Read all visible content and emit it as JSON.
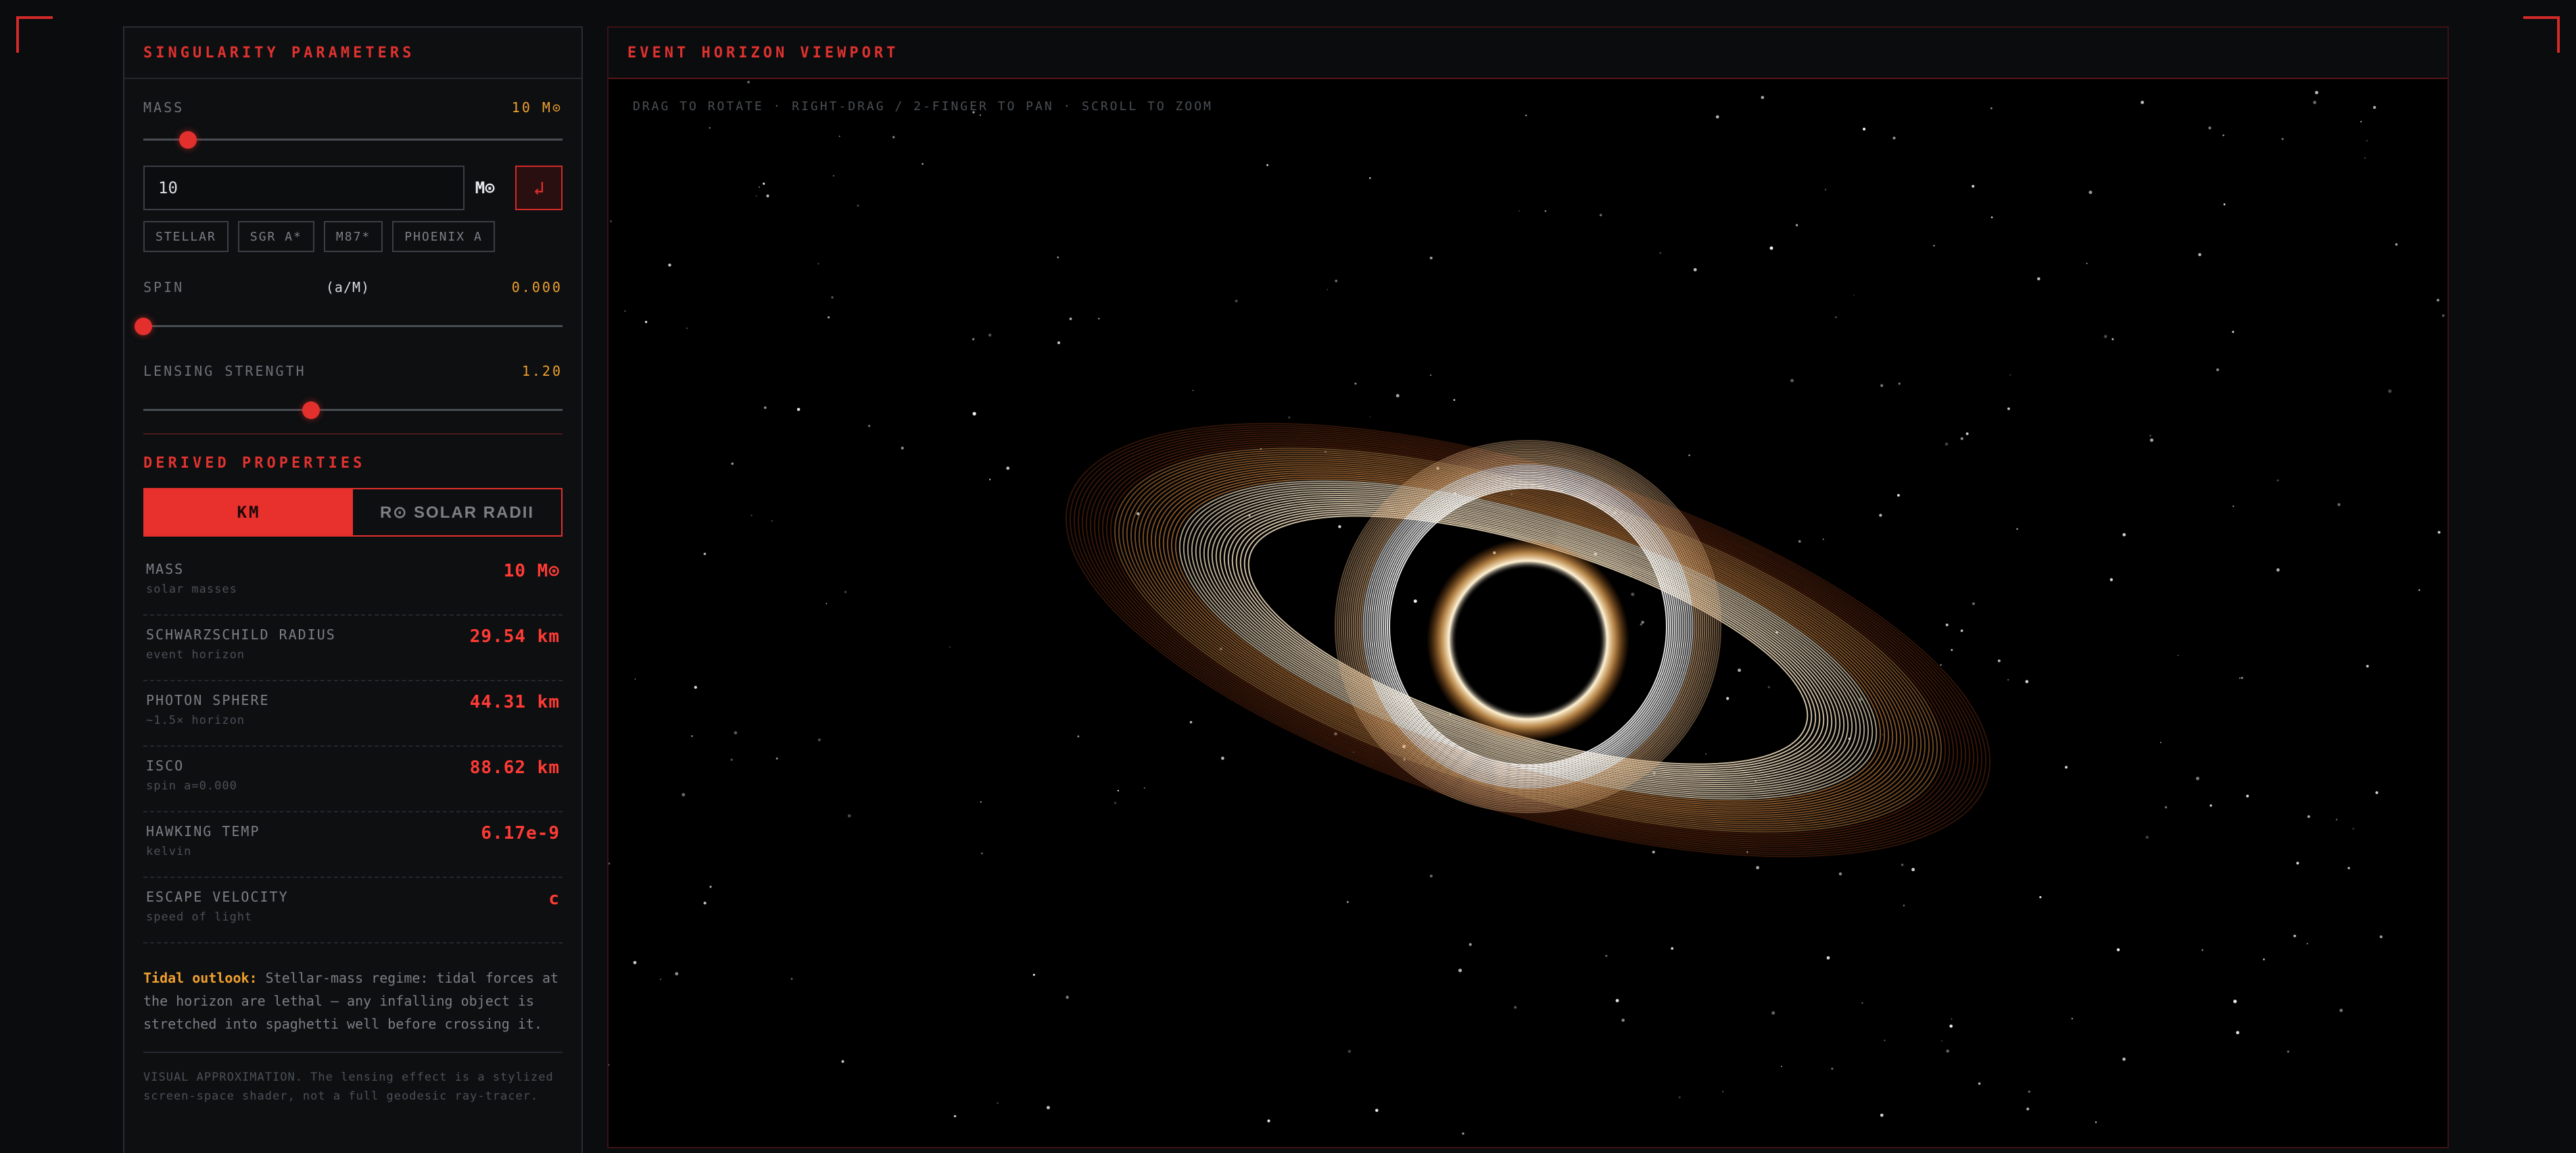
{
  "panel": {
    "title": "SINGULARITY PARAMETERS",
    "mass": {
      "label": "MASS",
      "value": "10 M⊙",
      "input_value": "10",
      "unit": "M⊙",
      "enter_symbol": "↲",
      "slider_fraction": 0.107
    },
    "presets": [
      "STELLAR",
      "SGR A*",
      "M87*",
      "PHOENIX A"
    ],
    "spin": {
      "label": "SPIN",
      "unit_label": "(a/M)",
      "value": "0.000",
      "slider_fraction": 0.0
    },
    "lensing": {
      "label": "LENSING STRENGTH",
      "value": "1.20",
      "slider_fraction": 0.4
    },
    "derived_title": "DERIVED PROPERTIES",
    "toggle": {
      "km": "KM",
      "solar": "R⊙ SOLAR RADII"
    },
    "properties": [
      {
        "name": "MASS",
        "sub": "solar masses",
        "value": "10 M⊙"
      },
      {
        "name": "SCHWARZSCHILD RADIUS",
        "sub": "event horizon",
        "value": "29.54 km"
      },
      {
        "name": "PHOTON SPHERE",
        "sub": "~1.5× horizon",
        "value": "44.31 km"
      },
      {
        "name": "ISCO",
        "sub": "spin a=0.000",
        "value": "88.62 km"
      },
      {
        "name": "HAWKING TEMP",
        "sub": "kelvin",
        "value": "6.17e-9"
      },
      {
        "name": "ESCAPE VELOCITY",
        "sub": "speed of light",
        "value": "c"
      }
    ],
    "tidal": {
      "lead": "Tidal outlook:",
      "text": "Stellar-mass regime: tidal forces at the horizon are lethal — any infalling object is stretched into spaghetti well before crossing it."
    },
    "note": "VISUAL APPROXIMATION. The lensing effect is a stylized screen-space shader, not a full geodesic ray-tracer."
  },
  "viewport": {
    "title": "EVENT HORIZON VIEWPORT",
    "hint": "DRAG TO ROTATE · RIGHT-DRAG / 2-FINGER TO PAN · SCROLL TO ZOOM"
  },
  "colors": {
    "accent": "#e3302d",
    "value_orange": "#f0a030",
    "disk_gold": "#f3c98c"
  }
}
